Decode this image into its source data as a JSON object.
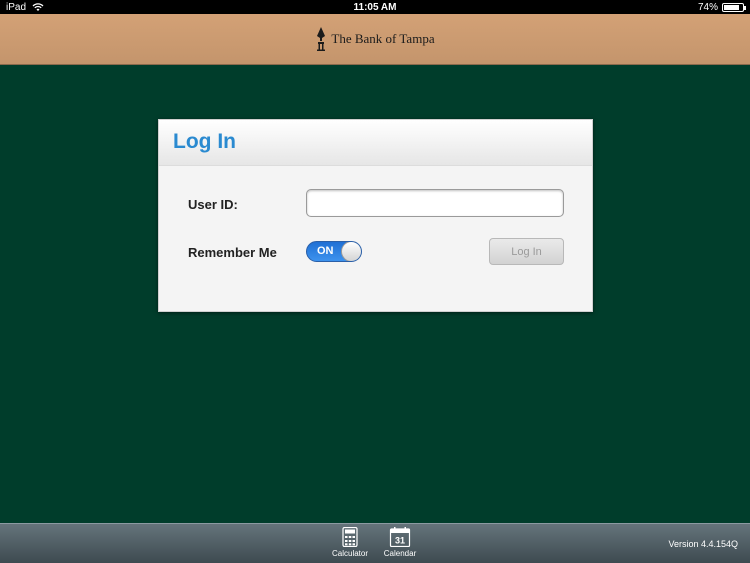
{
  "statusbar": {
    "device": "iPad",
    "time": "11:05 AM",
    "battery": "74%",
    "battery_level": 0.74
  },
  "header": {
    "brand": "The Bank of Tampa"
  },
  "login": {
    "title": "Log In",
    "userid_label": "User ID:",
    "userid_value": "",
    "remember_label": "Remember Me",
    "toggle_state": "ON",
    "login_button": "Log In"
  },
  "toolbar": {
    "calculator_label": "Calculator",
    "calendar_label": "Calendar",
    "calendar_day": "31",
    "version": "Version 4.4.154Q"
  },
  "colors": {
    "background": "#003d2b",
    "header": "#c89a70",
    "accent": "#2a8ad0",
    "toggle_on": "#2a7fe0"
  }
}
